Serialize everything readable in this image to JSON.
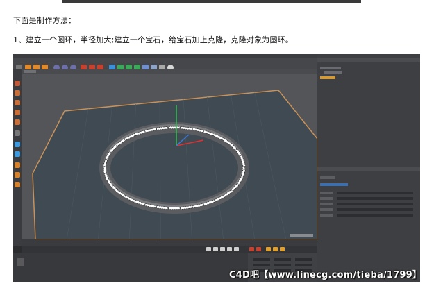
{
  "article": {
    "intro": "下面是制作方法：",
    "step1": "1、建立一个圆环，半径加大;建立一个宝石，给宝石加上克隆，克隆对象为圆环。"
  },
  "screenshot": {
    "watermark": "C4D吧【www.linecg.com/tieba/1799】"
  },
  "colors": {
    "ui_dark": "#2b2c2e",
    "viewport": "#545558",
    "floor": "#3f4a52",
    "floor_edge": "#c8925a",
    "torus": "#5a5c60",
    "gem": "#ffffff",
    "axis_x": "#e53030",
    "axis_y": "#30c050",
    "axis_z": "#3a7ad8"
  }
}
